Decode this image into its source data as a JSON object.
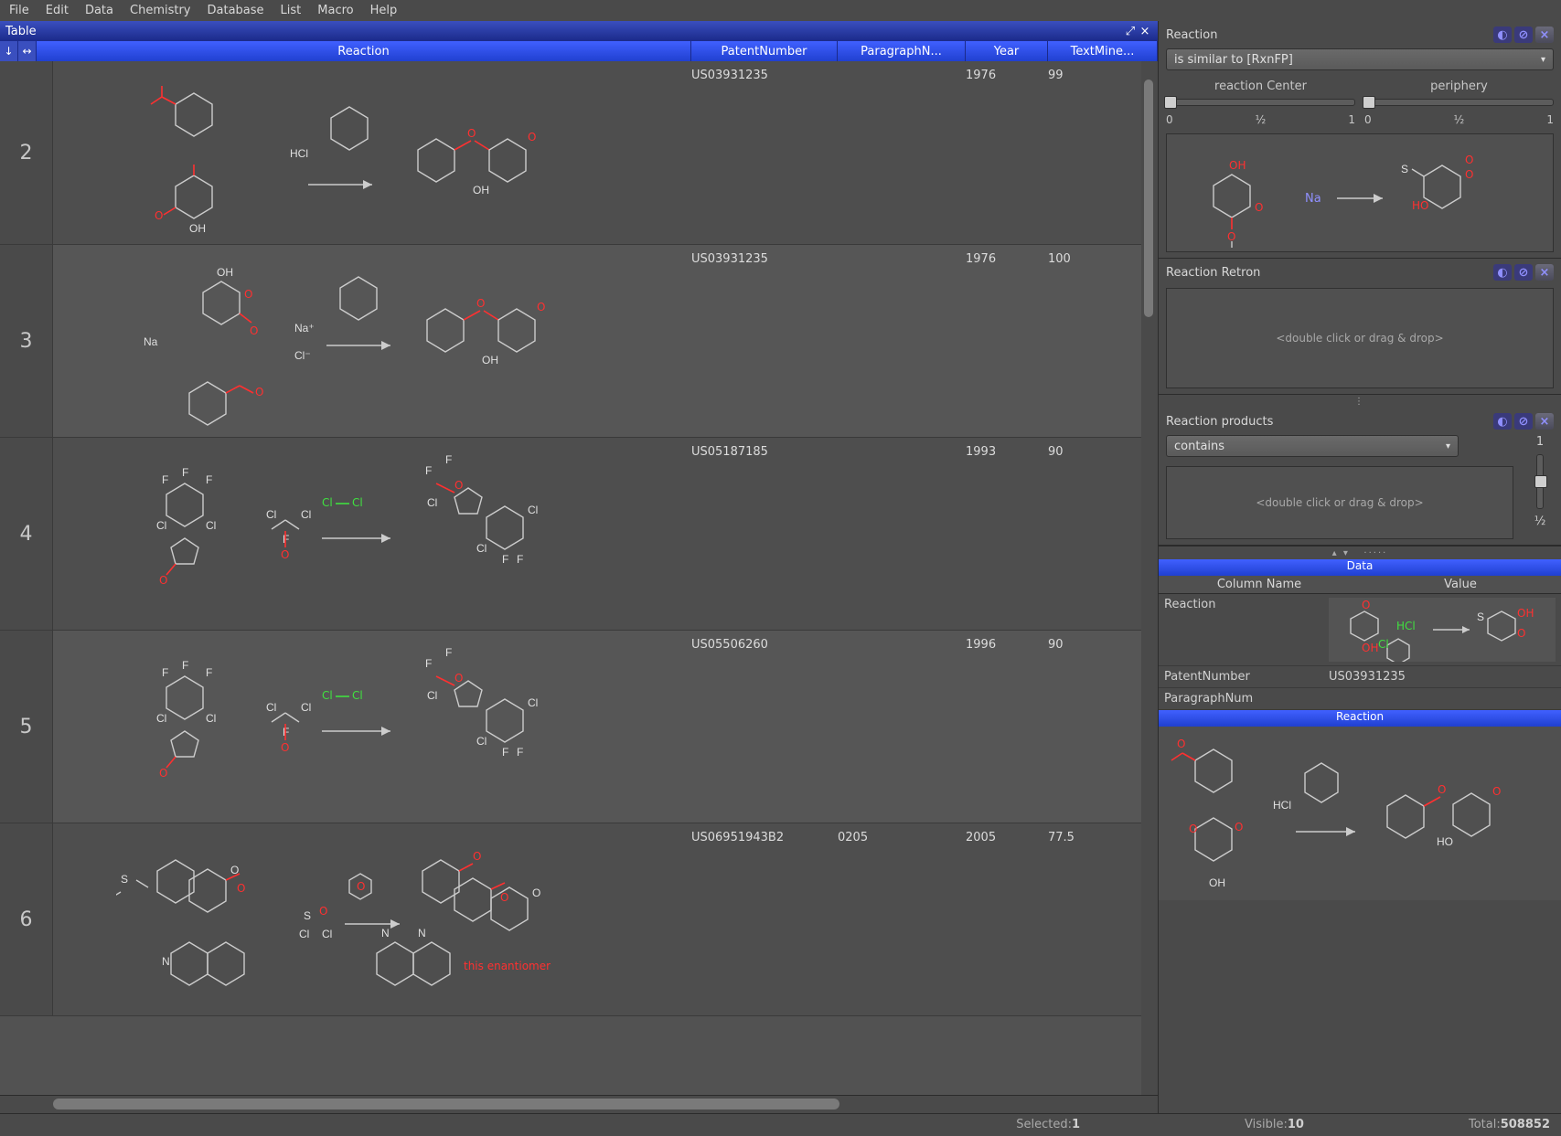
{
  "menu": [
    "File",
    "Edit",
    "Data",
    "Chemistry",
    "Database",
    "List",
    "Macro",
    "Help"
  ],
  "window": {
    "title": "Table"
  },
  "columns": [
    "Reaction",
    "PatentNumber",
    "ParagraphN...",
    "Year",
    "TextMine..."
  ],
  "rows": [
    {
      "num": "2",
      "patent": "US03931235",
      "para": "",
      "year": "1976",
      "tm": "99"
    },
    {
      "num": "3",
      "patent": "US03931235",
      "para": "",
      "year": "1976",
      "tm": "100"
    },
    {
      "num": "4",
      "patent": "US05187185",
      "para": "",
      "year": "1993",
      "tm": "90"
    },
    {
      "num": "5",
      "patent": "US05506260",
      "para": "",
      "year": "1996",
      "tm": "90"
    },
    {
      "num": "6",
      "patent": "US06951943B2",
      "para": "0205",
      "year": "2005",
      "tm": "77.5"
    }
  ],
  "labels": {
    "HCl": "HCl",
    "Na": "Na",
    "Na_plus": "Na⁺",
    "Cl_minus": "Cl⁻",
    "enantiomer": "this enantiomer",
    "Cl": "Cl",
    "F": "F",
    "O": "O",
    "S": "S",
    "OH": "OH"
  },
  "status": {
    "selected_l": "Selected:",
    "selected_v": "1",
    "visible_l": "Visible:",
    "visible_v": "10",
    "total_l": "Total:",
    "total_v": "508852"
  },
  "right": {
    "p1": {
      "title": "Reaction",
      "drop": "is similar to [RxnFP]",
      "s1": "reaction Center",
      "s2": "periphery",
      "ticks": [
        "0",
        "½",
        "1"
      ]
    },
    "p2": {
      "title": "Reaction Retron",
      "hint": "<double click or drag & drop>"
    },
    "p3": {
      "title": "Reaction products",
      "drop": "contains",
      "hint": "<double click or drag & drop>",
      "ticks": [
        "1",
        "½"
      ]
    },
    "data": {
      "title": "Data",
      "cols": [
        "Column Name",
        "Value"
      ],
      "r1": "Reaction",
      "r2": "PatentNumber",
      "r2v": "US03931235",
      "r3": "ParagraphNum",
      "rxnTitle": "Reaction"
    }
  }
}
